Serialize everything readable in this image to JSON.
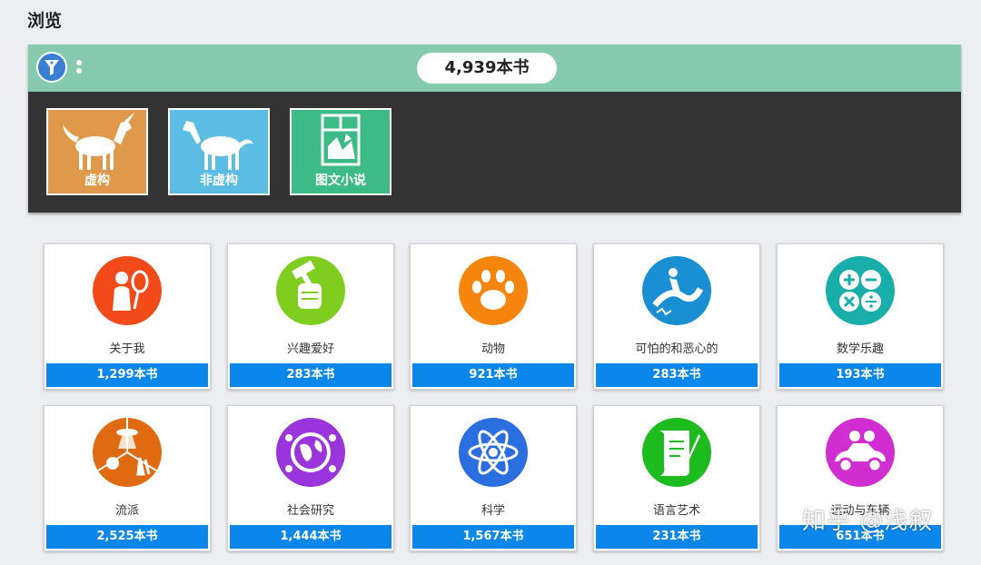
{
  "page": {
    "title": "浏览"
  },
  "header": {
    "total_count": "4,939本书",
    "filter_icon": "filter-icon",
    "more_icon": "more-vertical-icon"
  },
  "top_categories": [
    {
      "label": "虚构",
      "color": "#e0994a",
      "icon": "unicorn-icon"
    },
    {
      "label": "非虚构",
      "color": "#5bbde3",
      "icon": "horse-icon"
    },
    {
      "label": "图文小说",
      "color": "#3dbb86",
      "icon": "comic-panel-icon"
    }
  ],
  "categories": [
    {
      "label": "关于我",
      "count": "1,299本书",
      "color": "#f24a19",
      "icon": "mirror-person-icon"
    },
    {
      "label": "兴趣爱好",
      "count": "283本书",
      "color": "#7fce1f",
      "icon": "fist-hammer-icon"
    },
    {
      "label": "动物",
      "count": "921本书",
      "color": "#f5850d",
      "icon": "paw-icon"
    },
    {
      "label": "可怕的和恶心的",
      "count": "283本书",
      "color": "#1b8fd4",
      "icon": "scary-slide-icon"
    },
    {
      "label": "数学乐趣",
      "count": "193本书",
      "color": "#1aaeaa",
      "icon": "math-symbols-icon"
    },
    {
      "label": "流派",
      "count": "2,525本书",
      "color": "#e06a12",
      "icon": "genre-icon"
    },
    {
      "label": "社会研究",
      "count": "1,444本书",
      "color": "#9a35dc",
      "icon": "globe-people-icon"
    },
    {
      "label": "科学",
      "count": "1,567本书",
      "color": "#2a6ee0",
      "icon": "atom-icon"
    },
    {
      "label": "语言艺术",
      "count": "231本书",
      "color": "#1dbb1d",
      "icon": "scroll-quill-icon"
    },
    {
      "label": "运动与车辆",
      "count": "651本书",
      "color": "#d12ed1",
      "icon": "race-car-icon"
    }
  ],
  "watermark": "知乎 @浅叙"
}
